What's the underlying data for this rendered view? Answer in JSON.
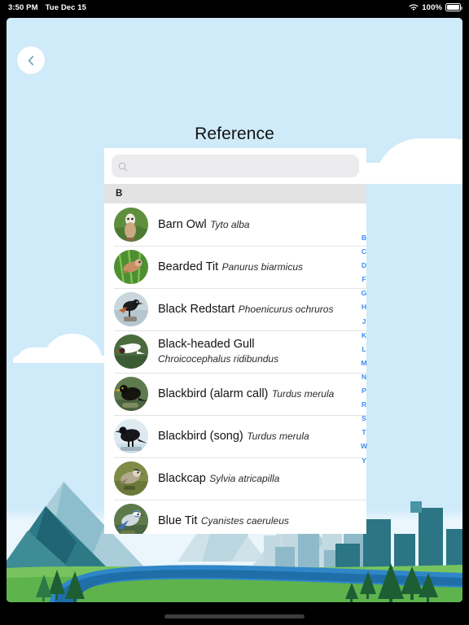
{
  "status_bar": {
    "time": "3:50 PM",
    "date": "Tue Dec 15",
    "wifi_icon": "wifi-icon",
    "battery_percent": "100%",
    "battery_icon": "battery-full-icon"
  },
  "nav": {
    "back_icon": "chevron-left-icon",
    "back_label": ""
  },
  "header": {
    "title": "Reference"
  },
  "search": {
    "icon": "search-icon",
    "value": "",
    "placeholder": ""
  },
  "list": {
    "section_header": "B",
    "items": [
      {
        "name": "Barn Owl",
        "scientific": "Tyto alba",
        "thumb": "barn-owl-photo"
      },
      {
        "name": "Bearded Tit",
        "scientific": "Panurus biarmicus",
        "thumb": "bearded-tit-photo"
      },
      {
        "name": "Black Redstart",
        "scientific": "Phoenicurus ochruros",
        "thumb": "black-redstart-photo"
      },
      {
        "name": "Black-headed Gull",
        "scientific": "Chroicocephalus ridibundus",
        "thumb": "black-headed-gull-photo"
      },
      {
        "name": "Blackbird (alarm call)",
        "scientific": "Turdus merula",
        "thumb": "blackbird-alarm-photo"
      },
      {
        "name": "Blackbird (song)",
        "scientific": "Turdus merula",
        "thumb": "blackbird-song-photo"
      },
      {
        "name": "Blackcap",
        "scientific": "Sylvia atricapilla",
        "thumb": "blackcap-photo"
      },
      {
        "name": "Blue Tit",
        "scientific": "Cyanistes caeruleus",
        "thumb": "blue-tit-photo"
      }
    ]
  },
  "alpha_index": {
    "letters": [
      "B",
      "C",
      "D",
      "F",
      "G",
      "H",
      "J",
      "K",
      "L",
      "M",
      "N",
      "P",
      "R",
      "S",
      "T",
      "W",
      "Y"
    ]
  },
  "colors": {
    "sky": "#cfeaf9",
    "index_blue": "#3b8cf5",
    "section_gray": "#e3e3e3",
    "search_gray": "#ececee",
    "panel_white": "#ffffff",
    "grass_green": "#6ec05a",
    "river_blue": "#2b7fc4",
    "mountain_teal": "#2d7a86",
    "city_teal": "#1f6f7e"
  }
}
